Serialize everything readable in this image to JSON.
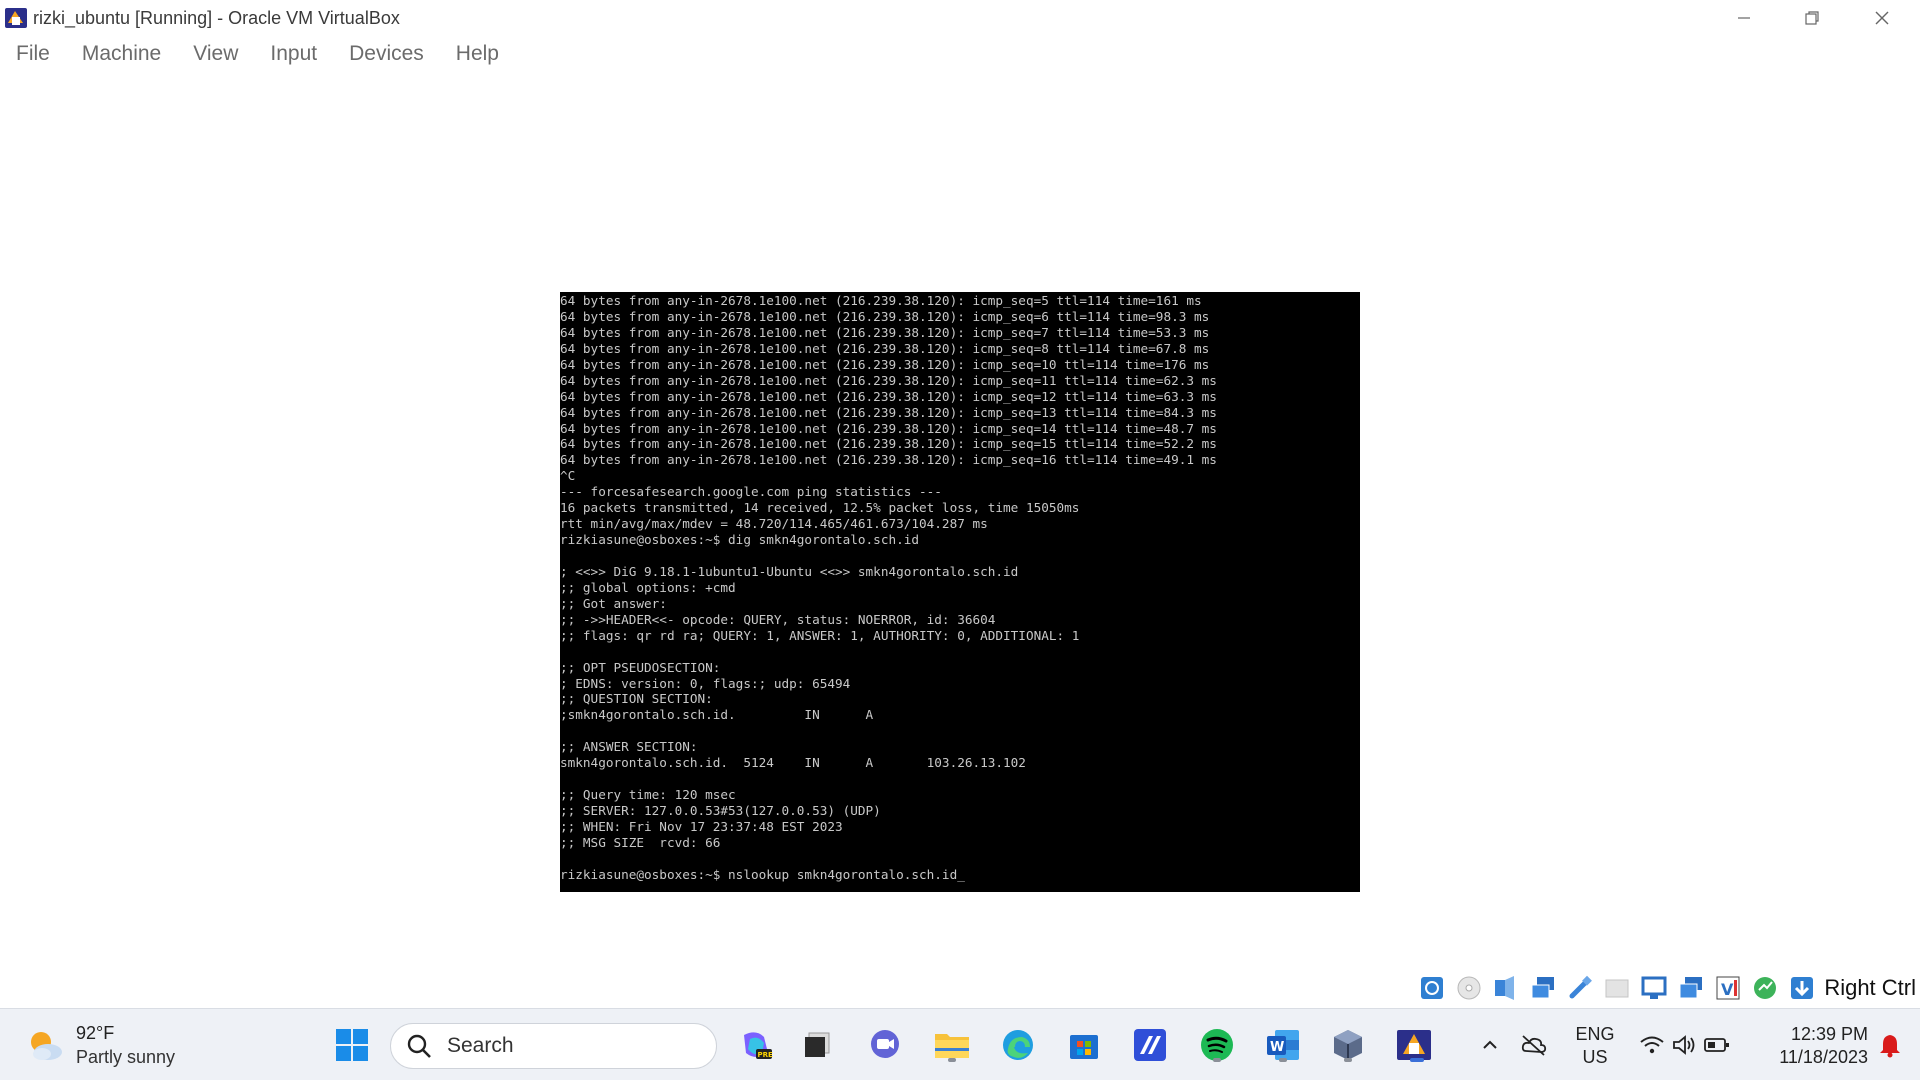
{
  "window": {
    "title": "rizki_ubuntu [Running] - Oracle VM VirtualBox"
  },
  "menu": [
    "File",
    "Machine",
    "View",
    "Input",
    "Devices",
    "Help"
  ],
  "terminal": {
    "lines": [
      "64 bytes from any-in-2678.1e100.net (216.239.38.120): icmp_seq=5 ttl=114 time=161 ms",
      "64 bytes from any-in-2678.1e100.net (216.239.38.120): icmp_seq=6 ttl=114 time=98.3 ms",
      "64 bytes from any-in-2678.1e100.net (216.239.38.120): icmp_seq=7 ttl=114 time=53.3 ms",
      "64 bytes from any-in-2678.1e100.net (216.239.38.120): icmp_seq=8 ttl=114 time=67.8 ms",
      "64 bytes from any-in-2678.1e100.net (216.239.38.120): icmp_seq=10 ttl=114 time=176 ms",
      "64 bytes from any-in-2678.1e100.net (216.239.38.120): icmp_seq=11 ttl=114 time=62.3 ms",
      "64 bytes from any-in-2678.1e100.net (216.239.38.120): icmp_seq=12 ttl=114 time=63.3 ms",
      "64 bytes from any-in-2678.1e100.net (216.239.38.120): icmp_seq=13 ttl=114 time=84.3 ms",
      "64 bytes from any-in-2678.1e100.net (216.239.38.120): icmp_seq=14 ttl=114 time=48.7 ms",
      "64 bytes from any-in-2678.1e100.net (216.239.38.120): icmp_seq=15 ttl=114 time=52.2 ms",
      "64 bytes from any-in-2678.1e100.net (216.239.38.120): icmp_seq=16 ttl=114 time=49.1 ms",
      "^C",
      "--- forcesafesearch.google.com ping statistics ---",
      "16 packets transmitted, 14 received, 12.5% packet loss, time 15050ms",
      "rtt min/avg/max/mdev = 48.720/114.465/461.673/104.287 ms",
      "rizkiasune@osboxes:~$ dig smkn4gorontalo.sch.id",
      "",
      "; <<>> DiG 9.18.1-1ubuntu1-Ubuntu <<>> smkn4gorontalo.sch.id",
      ";; global options: +cmd",
      ";; Got answer:",
      ";; ->>HEADER<<- opcode: QUERY, status: NOERROR, id: 36604",
      ";; flags: qr rd ra; QUERY: 1, ANSWER: 1, AUTHORITY: 0, ADDITIONAL: 1",
      "",
      ";; OPT PSEUDOSECTION:",
      "; EDNS: version: 0, flags:; udp: 65494",
      ";; QUESTION SECTION:",
      ";smkn4gorontalo.sch.id.         IN      A",
      "",
      ";; ANSWER SECTION:",
      "smkn4gorontalo.sch.id.  5124    IN      A       103.26.13.102",
      "",
      ";; Query time: 120 msec",
      ";; SERVER: 127.0.0.53#53(127.0.0.53) (UDP)",
      ";; WHEN: Fri Nov 17 23:37:48 EST 2023",
      ";; MSG SIZE  rcvd: 66",
      "",
      "rizkiasune@osboxes:~$ nslookup smkn4gorontalo.sch.id_"
    ]
  },
  "statusbar": {
    "icons": [
      "hard-disk-icon",
      "optical-drive-icon",
      "audio-icon",
      "network-icon",
      "usb-icon",
      "shared-folders-icon",
      "display-icon",
      "recording-icon",
      "virtualization-icon",
      "cpu-activity-icon",
      "mouse-integration-icon"
    ],
    "host_key": "Right Ctrl"
  },
  "taskbar": {
    "weather_temp": "92°F",
    "weather_desc": "Partly sunny",
    "search_label": "Search",
    "language_line1": "ENG",
    "language_line2": "US",
    "time": "12:39 PM",
    "date": "11/18/2023"
  }
}
